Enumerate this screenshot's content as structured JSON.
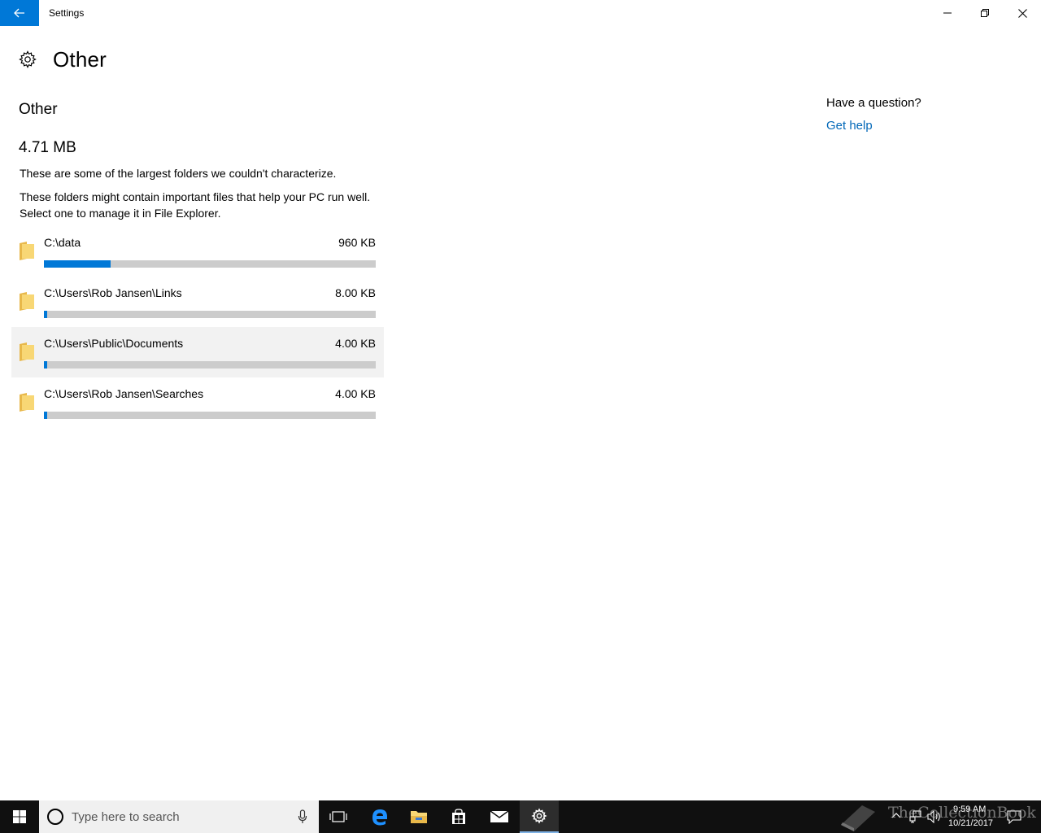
{
  "window": {
    "app_title": "Settings"
  },
  "header": {
    "page_title": "Other"
  },
  "main": {
    "section_title": "Other",
    "total_size": "4.71 MB",
    "description_1": "These are some of the largest folders we couldn't characterize.",
    "description_2": "These folders might contain important files that help your PC run well. Select one to manage it in File Explorer.",
    "folders": [
      {
        "path": "C:\\data",
        "size": "960 KB",
        "fill_fraction": 0.2
      },
      {
        "path": "C:\\Users\\Rob Jansen\\Links",
        "size": "8.00 KB",
        "fill_fraction": 0.01
      },
      {
        "path": "C:\\Users\\Public\\Documents",
        "size": "4.00 KB",
        "fill_fraction": 0.01
      },
      {
        "path": "C:\\Users\\Rob Jansen\\Searches",
        "size": "4.00 KB",
        "fill_fraction": 0.01
      }
    ]
  },
  "help": {
    "question": "Have a question?",
    "link": "Get help"
  },
  "taskbar": {
    "search_placeholder": "Type here to search",
    "time": "9:59 AM",
    "date": "10/21/2017"
  },
  "watermark": {
    "text": "TheCollectionBook"
  },
  "colors": {
    "accent": "#0078d7",
    "bar_track": "#cccccc",
    "link": "#0067b8",
    "folder_yellow": "#f8d775"
  }
}
